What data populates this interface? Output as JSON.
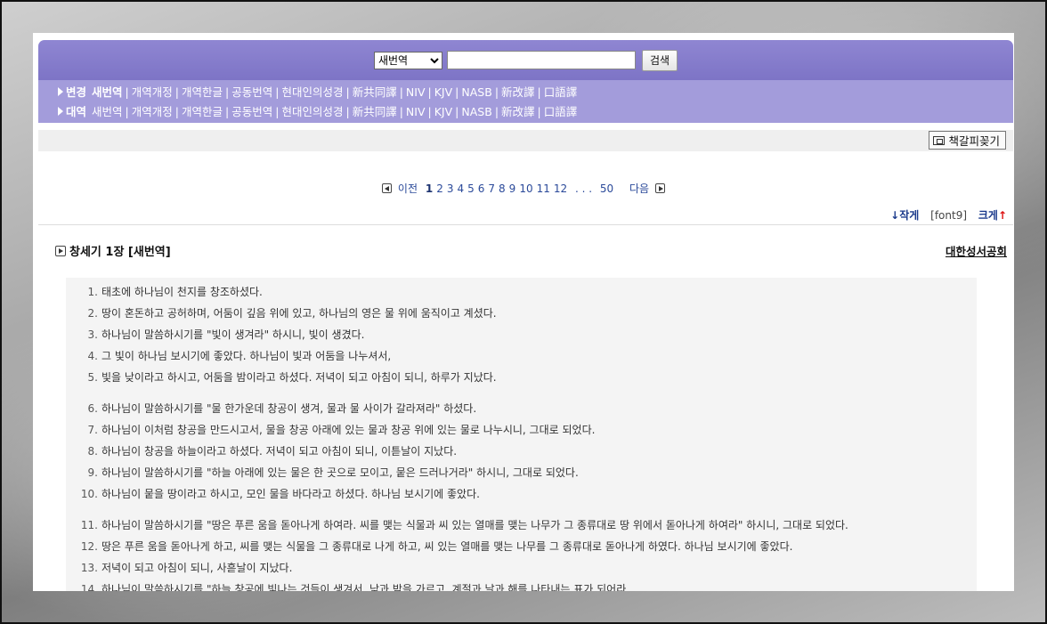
{
  "search": {
    "version_selected": "새번역",
    "version_options": [
      "새번역"
    ],
    "query": "",
    "button_label": "검색"
  },
  "nav": {
    "rows": [
      {
        "head": "변경",
        "items": [
          "새번역",
          "개역개정",
          "개역한글",
          "공동번역",
          "현대인의성경",
          "新共同譯",
          "NIV",
          "KJV",
          "NASB",
          "新改譯",
          "口語譯"
        ],
        "active_index": 0
      },
      {
        "head": "대역",
        "items": [
          "새번역",
          "개역개정",
          "개역한글",
          "공동번역",
          "현대인의성경",
          "新共同譯",
          "NIV",
          "KJV",
          "NASB",
          "新改譯",
          "口語譯"
        ],
        "active_index": -1
      }
    ]
  },
  "toolbar": {
    "bookmark_label": "책갈피꽂기"
  },
  "pager": {
    "prev_label": "이전",
    "next_label": "다음",
    "pages": [
      "1",
      "2",
      "3",
      "4",
      "5",
      "6",
      "7",
      "8",
      "9",
      "10",
      "11",
      "12"
    ],
    "current": "1",
    "ellipsis": ". . .",
    "last": "50"
  },
  "font_control": {
    "smaller_label": "↓작게",
    "current_label": "[font9]",
    "bigger_label": "크게",
    "bigger_arrow": "↑"
  },
  "chapter": {
    "title": "창세기 1장 [새번역]",
    "publisher": "대한성서공회"
  },
  "verses": [
    {
      "n": "1.",
      "text": "태초에 하나님이 천지를 창조하셨다.",
      "gap": false
    },
    {
      "n": "2.",
      "text": "땅이 혼돈하고 공허하며, 어둠이 깊음 위에 있고, 하나님의 영은 물 위에 움직이고 계셨다.",
      "gap": false
    },
    {
      "n": "3.",
      "text": "하나님이 말씀하시기를 \"빛이 생겨라\" 하시니, 빛이 생겼다.",
      "gap": false
    },
    {
      "n": "4.",
      "text": "그 빛이 하나님 보시기에 좋았다. 하나님이 빛과 어둠을 나누셔서,",
      "gap": false
    },
    {
      "n": "5.",
      "text": "빛을 낮이라고 하시고, 어둠을 밤이라고 하셨다. 저녁이 되고 아침이 되니, 하루가 지났다.",
      "gap": false
    },
    {
      "n": "6.",
      "text": "하나님이 말씀하시기를 \"물 한가운데 창공이 생겨, 물과 물 사이가 갈라져라\" 하셨다.",
      "gap": true
    },
    {
      "n": "7.",
      "text": "하나님이 이처럼 창공을 만드시고서, 물을 창공 아래에 있는 물과 창공 위에 있는 물로 나누시니, 그대로 되었다.",
      "gap": false
    },
    {
      "n": "8.",
      "text": "하나님이 창공을 하늘이라고 하셨다. 저녁이 되고 아침이 되니, 이튿날이 지났다.",
      "gap": false
    },
    {
      "n": "9.",
      "text": "하나님이 말씀하시기를 \"하늘 아래에 있는 물은 한 곳으로 모이고, 뭍은 드러나거라\" 하시니, 그대로 되었다.",
      "gap": false
    },
    {
      "n": "10.",
      "text": "하나님이 뭍을 땅이라고 하시고, 모인 물을 바다라고 하셨다. 하나님 보시기에 좋았다.",
      "gap": false
    },
    {
      "n": "11.",
      "text": "하나님이 말씀하시기를 \"땅은 푸른 움을 돋아나게 하여라. 씨를 맺는 식물과 씨 있는 열매를 맺는 나무가 그 종류대로 땅 위에서 돋아나게 하여라\" 하시니, 그대로 되었다.",
      "gap": true
    },
    {
      "n": "12.",
      "text": "땅은 푸른 움을 돋아나게 하고, 씨를 맺는 식물을 그 종류대로 나게 하고, 씨 있는 열매를 맺는 나무를 그 종류대로 돋아나게 하였다. 하나님 보시기에 좋았다.",
      "gap": false
    },
    {
      "n": "13.",
      "text": "저녁이 되고 아침이 되니, 사흗날이 지났다.",
      "gap": false
    },
    {
      "n": "14.",
      "text": "하나님이 말씀하시기를 \"하늘 창공에 빛나는 것들이 생겨서, 낮과 밤을 가르고, 계절과 날과 해를 나타내는 표가 되어라.",
      "gap": false
    }
  ]
}
